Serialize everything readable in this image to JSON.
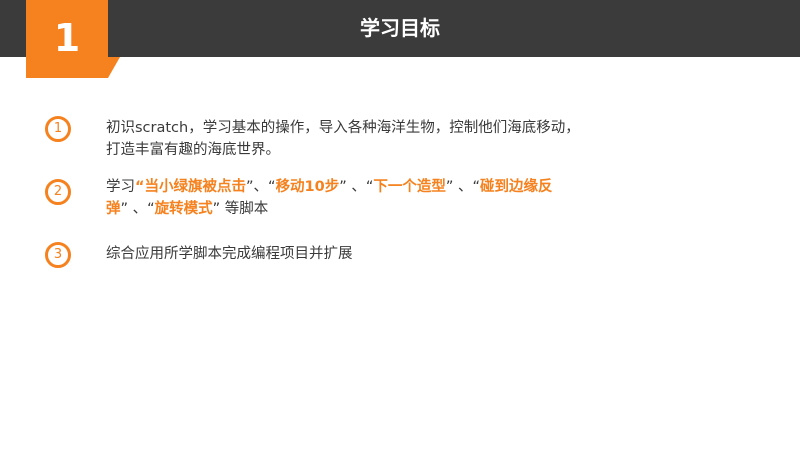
{
  "header": {
    "number": "1",
    "title": "学习目标"
  },
  "items": [
    {
      "num": "1",
      "line1": "初识scratch，学习基本的操作，导入各种海洋生物，控制他们海底移动，",
      "line2": "打造丰富有趣的海底世界。"
    },
    {
      "num": "2",
      "p0": "学习",
      "q0": "“",
      "h1": "当小绿旗被点击",
      "s1": "”、“",
      "h2": "移动10步",
      "s2": "” 、“",
      "h3": "下一个造型",
      "s3": "” 、“",
      "h4a": "碰到边缘反",
      "h4b": "弹",
      "s4": "” 、“",
      "h5": "旋转模式",
      "s5": "” ",
      "tail": "等脚本"
    },
    {
      "num": "3",
      "line1": "综合应用所学脚本完成编程项目并扩展"
    }
  ],
  "colors": {
    "accent": "#f5821f",
    "header_bg": "#3b3b3b",
    "text": "#3a3a3a"
  }
}
